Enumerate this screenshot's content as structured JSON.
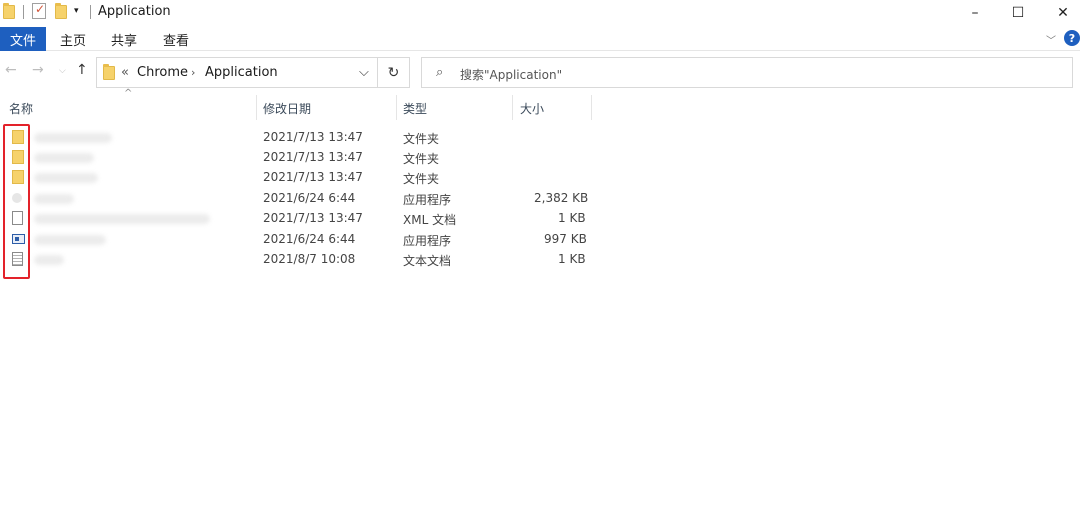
{
  "window": {
    "title": "Application",
    "minimize": "–",
    "maximize": "☐",
    "close": "✕"
  },
  "ribbon": {
    "tabs": [
      "文件",
      "主页",
      "共享",
      "查看"
    ],
    "expand_icon": "chevron-down-icon",
    "help": "?"
  },
  "address": {
    "overflow": "«",
    "path": [
      "Chrome",
      "Application"
    ],
    "dropdown": "⌵",
    "refresh": "↻"
  },
  "search": {
    "placeholder": "搜索\"Application\""
  },
  "columns": {
    "name": "名称",
    "modified": "修改日期",
    "type": "类型",
    "size": "大小"
  },
  "files": [
    {
      "icon": "folder",
      "name": "",
      "modified": "2021/7/13 13:47",
      "type": "文件夹",
      "size": ""
    },
    {
      "icon": "folder",
      "name": "",
      "modified": "2021/7/13 13:47",
      "type": "文件夹",
      "size": ""
    },
    {
      "icon": "folder",
      "name": "",
      "modified": "2021/7/13 13:47",
      "type": "文件夹",
      "size": ""
    },
    {
      "icon": "app-blank",
      "name": "",
      "modified": "2021/6/24 6:44",
      "type": "应用程序",
      "size": "2,382 KB"
    },
    {
      "icon": "file",
      "name": "",
      "modified": "2021/7/13 13:47",
      "type": "XML 文档",
      "size": "1 KB"
    },
    {
      "icon": "app",
      "name": "",
      "modified": "2021/6/24 6:44",
      "type": "应用程序",
      "size": "997 KB"
    },
    {
      "icon": "text",
      "name": "",
      "modified": "2021/8/7 10:08",
      "type": "文本文档",
      "size": "1 KB"
    }
  ],
  "colors": {
    "accent": "#1e5fbf",
    "highlight": "#e3222a"
  }
}
